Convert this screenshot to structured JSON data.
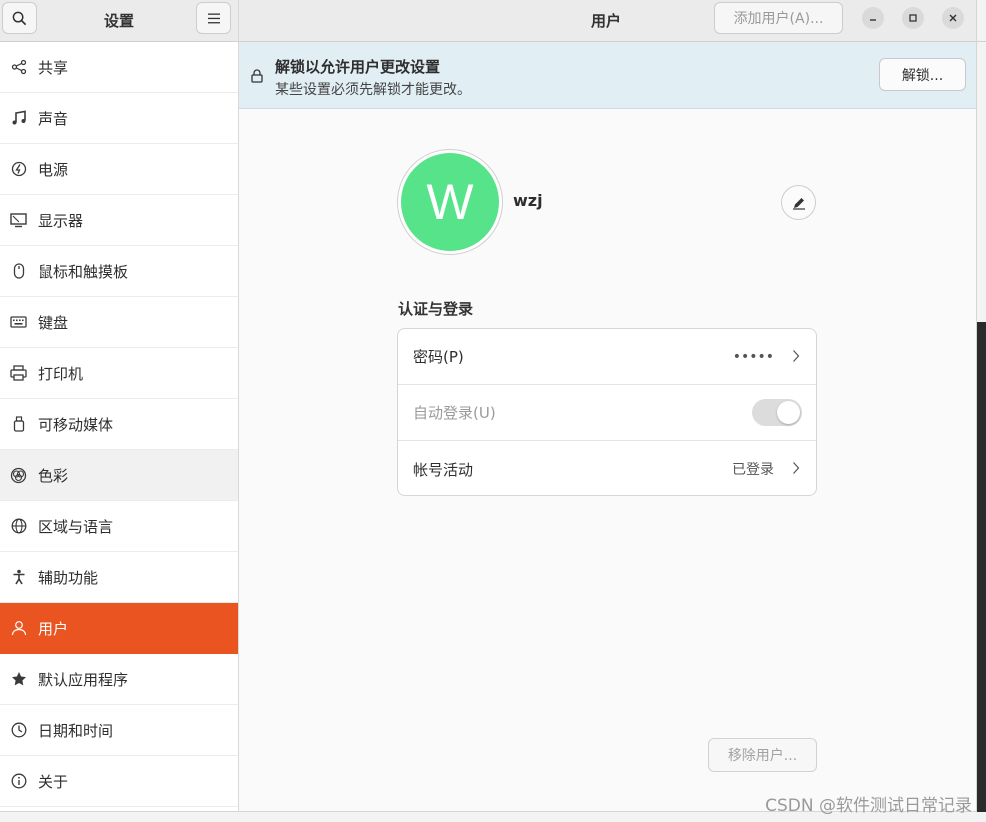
{
  "sidebar": {
    "title": "设置",
    "search_icon": "search-icon",
    "menu_icon": "hamburger-menu-icon",
    "items": [
      {
        "label": "共享",
        "icon": "share-icon"
      },
      {
        "label": "声音",
        "icon": "music-note-icon"
      },
      {
        "label": "电源",
        "icon": "power-icon"
      },
      {
        "label": "显示器",
        "icon": "display-icon"
      },
      {
        "label": "鼠标和触摸板",
        "icon": "mouse-icon"
      },
      {
        "label": "键盘",
        "icon": "keyboard-icon"
      },
      {
        "label": "打印机",
        "icon": "printer-icon"
      },
      {
        "label": "可移动媒体",
        "icon": "usb-drive-icon"
      },
      {
        "label": "色彩",
        "icon": "color-icon"
      },
      {
        "label": "区域与语言",
        "icon": "globe-icon"
      },
      {
        "label": "辅助功能",
        "icon": "accessibility-icon"
      },
      {
        "label": "用户",
        "icon": "user-icon"
      },
      {
        "label": "默认应用程序",
        "icon": "star-icon"
      },
      {
        "label": "日期和时间",
        "icon": "clock-icon"
      },
      {
        "label": "关于",
        "icon": "info-icon"
      }
    ],
    "selected_index": 11,
    "hover_index": 8
  },
  "header": {
    "title": "用户",
    "add_user_label": "添加用户(A)...",
    "minimize_icon": "minimize-icon",
    "maximize_icon": "maximize-icon",
    "close_icon": "close-icon"
  },
  "infobar": {
    "title": "解锁以允许用户更改设置",
    "subtitle": "某些设置必须先解锁才能更改。",
    "unlock_label": "解锁...",
    "lock_icon": "lock-icon"
  },
  "user": {
    "avatar_letter": "W",
    "avatar_color": "#57e389",
    "name": "wzj"
  },
  "auth": {
    "section_title": "认证与登录",
    "rows": [
      {
        "label": "密码(P)",
        "value": "•••••",
        "enabled": true
      },
      {
        "label": "自动登录(U)",
        "value": "",
        "enabled": false
      },
      {
        "label": "帐号活动",
        "value": "已登录",
        "enabled": true
      }
    ]
  },
  "remove_user_label": "移除用户...",
  "watermark": "CSDN @软件测试日常记录",
  "colors": {
    "accent": "#e95420",
    "infobar_bg": "#e1eef4"
  }
}
